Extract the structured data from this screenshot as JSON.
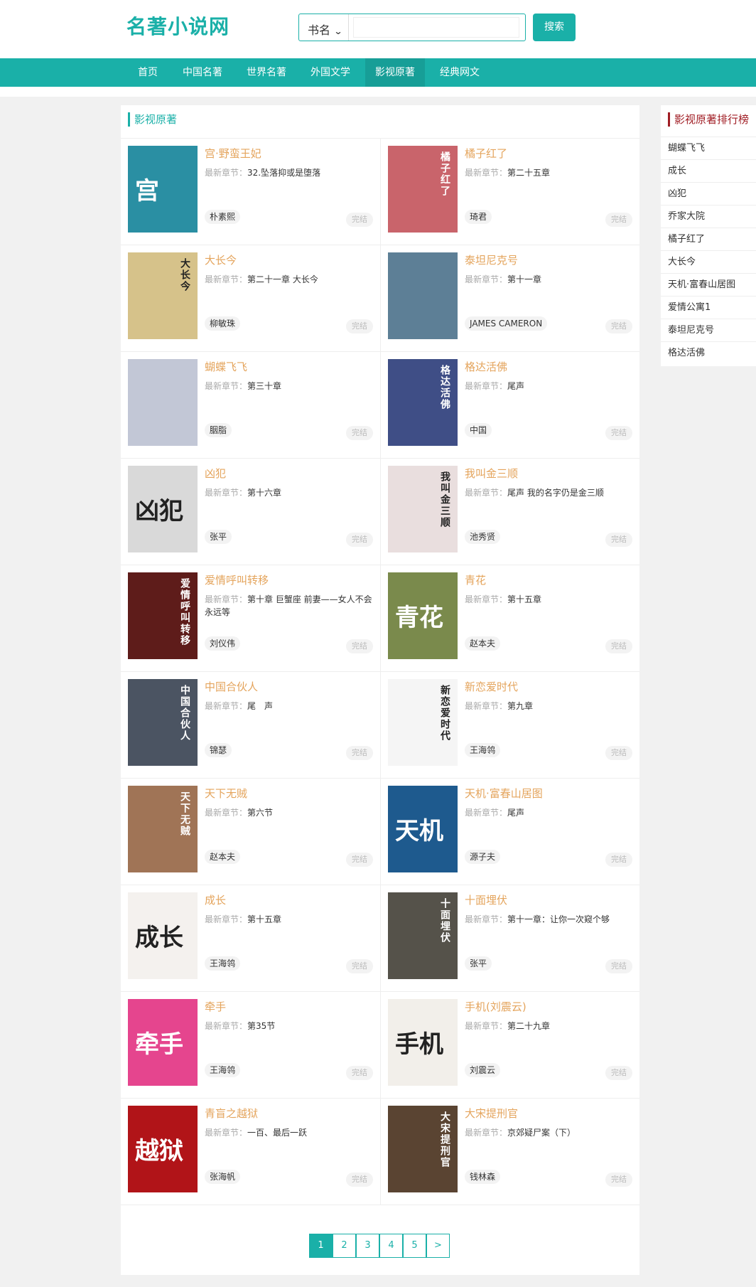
{
  "header": {
    "logo": "名著小说网",
    "search": {
      "select_value": "书名",
      "input_value": "",
      "button_label": "搜索"
    }
  },
  "nav": {
    "items": [
      "首页",
      "中国名著",
      "世界名著",
      "外国文学",
      "影视原著",
      "经典网文"
    ],
    "active_index": 4
  },
  "main": {
    "title": "影视原著",
    "chapter_label": "最新章节：",
    "books": [
      {
        "title": "宫·野蛮王妃",
        "chapter": "32.坠落抑或是堕落",
        "author": "朴素熙",
        "status": "完结",
        "cover_text": "宫",
        "cover_bg": "#2a8fa3"
      },
      {
        "title": "橘子红了",
        "chapter": "第二十五章",
        "author": "琦君",
        "status": "完结",
        "cover_text": "橘子红了",
        "cover_bg": "#c9646b"
      },
      {
        "title": "大长今",
        "chapter": "第二十一章 大长今",
        "author": "柳敏珠",
        "status": "完结",
        "cover_text": "大长今",
        "cover_bg": "#d6c28a"
      },
      {
        "title": "泰坦尼克号",
        "chapter": "第十一章",
        "author": "JAMES CAMERON",
        "status": "完结",
        "cover_text": "",
        "cover_bg": "#5d7f96"
      },
      {
        "title": "蝴蝶飞飞",
        "chapter": "第三十章",
        "author": "胭脂",
        "status": "完结",
        "cover_text": "",
        "cover_bg": "#c2c7d6"
      },
      {
        "title": "格达活佛",
        "chapter": "尾声",
        "author": "中国",
        "status": "完结",
        "cover_text": "格达活佛",
        "cover_bg": "#3f4e86"
      },
      {
        "title": "凶犯",
        "chapter": "第十六章",
        "author": "张平",
        "status": "完结",
        "cover_text": "凶犯",
        "cover_bg": "#d9d9d9"
      },
      {
        "title": "我叫金三顺",
        "chapter": "尾声 我的名字仍是金三顺",
        "author": "池秀贤",
        "status": "完结",
        "cover_text": "我叫金三顺",
        "cover_bg": "#e9dede"
      },
      {
        "title": "爱情呼叫转移",
        "chapter": "第十章 巨蟹座 前妻——女人不会永远等",
        "author": "刘仪伟",
        "status": "完结",
        "cover_text": "爱情呼叫转移",
        "cover_bg": "#5e1c1a"
      },
      {
        "title": "青花",
        "chapter": "第十五章",
        "author": "赵本夫",
        "status": "完结",
        "cover_text": "青花",
        "cover_bg": "#7a8a4c"
      },
      {
        "title": "中国合伙人",
        "chapter": "尾　声",
        "author": "锦瑟",
        "status": "完结",
        "cover_text": "中国合伙人",
        "cover_bg": "#4b5462"
      },
      {
        "title": "新恋爱时代",
        "chapter": "第九章",
        "author": "王海鸰",
        "status": "完结",
        "cover_text": "新恋爱时代",
        "cover_bg": "#f5f5f5"
      },
      {
        "title": "天下无贼",
        "chapter": "第六节",
        "author": "赵本夫",
        "status": "完结",
        "cover_text": "天下无贼",
        "cover_bg": "#a07456"
      },
      {
        "title": "天机·富春山居图",
        "chapter": "尾声",
        "author": "源子夫",
        "status": "完结",
        "cover_text": "天机",
        "cover_bg": "#1e5a8e"
      },
      {
        "title": "成长",
        "chapter": "第十五章",
        "author": "王海鸰",
        "status": "完结",
        "cover_text": "成长",
        "cover_bg": "#f4f1ee"
      },
      {
        "title": "十面埋伏",
        "chapter": "第十一章：让你一次窥个够",
        "author": "张平",
        "status": "完结",
        "cover_text": "十面埋伏",
        "cover_bg": "#55524a"
      },
      {
        "title": "牵手",
        "chapter": "第35节",
        "author": "王海鸰",
        "status": "完结",
        "cover_text": "牵手",
        "cover_bg": "#e5458e"
      },
      {
        "title": "手机(刘震云)",
        "chapter": "第二十九章",
        "author": "刘震云",
        "status": "完结",
        "cover_text": "手机",
        "cover_bg": "#f2efea"
      },
      {
        "title": "青盲之越狱",
        "chapter": "一百、最后一跃",
        "author": "张海帆",
        "status": "完结",
        "cover_text": "越狱",
        "cover_bg": "#b11418"
      },
      {
        "title": "大宋提刑官",
        "chapter": "京郊疑尸案（下）",
        "author": "钱林森",
        "status": "完结",
        "cover_text": "大宋提刑官",
        "cover_bg": "#5a4432"
      }
    ]
  },
  "pagination": {
    "pages": [
      "1",
      "2",
      "3",
      "4",
      "5",
      ">"
    ],
    "active_index": 0
  },
  "sidebar": {
    "title": "影视原著排行榜",
    "items": [
      "蝴蝶飞飞",
      "成长",
      "凶犯",
      "乔家大院",
      "橘子红了",
      "大长今",
      "天机·富春山居图",
      "爱情公寓1",
      "泰坦尼克号",
      "格达活佛"
    ]
  },
  "colors": {
    "accent": "#1ab0a8",
    "title_orange": "#e4a45c",
    "rank_red": "#a01d24"
  }
}
